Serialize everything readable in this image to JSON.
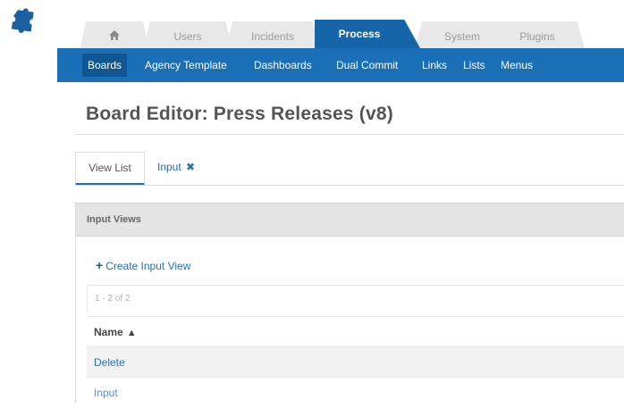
{
  "colors": {
    "brand_blue": "#1b6fb6",
    "active_tab": "#1565a8",
    "link": "#2a6fb0",
    "panel_header_bg": "#e4e4e4"
  },
  "logo": {
    "icon": "puzzle-piece-icon"
  },
  "top_tabs": [
    {
      "label": "",
      "icon": "home-icon"
    },
    {
      "label": "Users"
    },
    {
      "label": "Incidents"
    },
    {
      "label": "Process",
      "active": true
    },
    {
      "label": "System"
    },
    {
      "label": "Plugins"
    }
  ],
  "subnav": {
    "items": [
      {
        "label": "Boards",
        "active": true
      },
      {
        "label": "Agency Template"
      },
      {
        "label": "Dashboards"
      },
      {
        "label": "Dual Commit"
      },
      {
        "label": "Links"
      },
      {
        "label": "Lists"
      },
      {
        "label": "Menus"
      }
    ]
  },
  "page": {
    "title": "Board Editor: Press Releases (v8)"
  },
  "subtabs": {
    "view_list": "View List",
    "input": "Input",
    "input_close_glyph": "✖"
  },
  "panel": {
    "header": "Input Views",
    "create_label": "Create Input View",
    "create_glyph": "+",
    "count_text": "1 - 2 of 2",
    "column_name": "Name",
    "sort_glyph": "▲",
    "rows": [
      {
        "name": "Delete"
      },
      {
        "name": "Input"
      }
    ]
  }
}
